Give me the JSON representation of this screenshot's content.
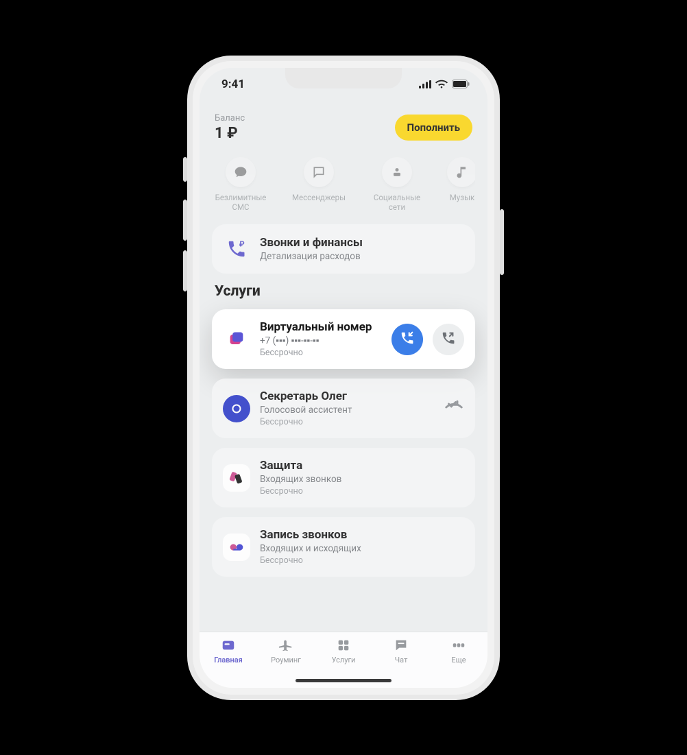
{
  "status": {
    "time": "9:41"
  },
  "balance": {
    "label": "Баланс",
    "value": "1 ₽",
    "topup_label": "Пополнить"
  },
  "quick_actions": {
    "items": [
      {
        "label": "Безлимитные\nСМС"
      },
      {
        "label": "Мессенджеры"
      },
      {
        "label": "Социальные\nсети"
      },
      {
        "label": "Музык"
      }
    ]
  },
  "finance_card": {
    "title": "Звонки и финансы",
    "subtitle": "Детализация расходов"
  },
  "section_title": "Услуги",
  "services": [
    {
      "title": "Виртуальный номер",
      "subtitle": "+7 (▪▪▪) ▪▪▪-▪▪-▪▪",
      "meta": "Бессрочно"
    },
    {
      "title": "Секретарь Олег",
      "subtitle": "Голосовой ассистент",
      "meta": "Бессрочно"
    },
    {
      "title": "Защита",
      "subtitle": "Входящих звонков",
      "meta": "Бессрочно"
    },
    {
      "title": "Запись звонков",
      "subtitle": "Входящих и исходящих",
      "meta": "Бессрочно"
    }
  ],
  "tabs": {
    "items": [
      {
        "label": "Главная"
      },
      {
        "label": "Роуминг"
      },
      {
        "label": "Услуги"
      },
      {
        "label": "Чат"
      },
      {
        "label": "Еще"
      }
    ]
  }
}
